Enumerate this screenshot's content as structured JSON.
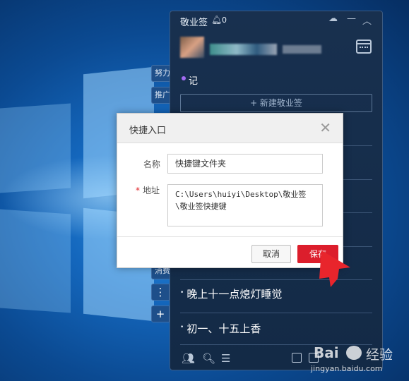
{
  "app": {
    "title": "敬业签",
    "notification_count": "0",
    "icons": [
      "bell-icon",
      "cloud-icon",
      "minimize-icon",
      "collapse-icon",
      "calendar-icon"
    ]
  },
  "section": {
    "label": "记"
  },
  "new_note_button": "+ 新建敬业签",
  "side_tabs": [
    "努力",
    "推广",
    "消费"
  ],
  "side_buttons": {
    "more": "⋮",
    "add": "+"
  },
  "notes": [
    "晚上十一点熄灯睡觉",
    "初一、十五上香"
  ],
  "dialog": {
    "title": "快捷入口",
    "name_label": "名称",
    "name_value": "快捷键文件夹",
    "address_label": "地址",
    "address_value": "C:\\Users\\huiyi\\Desktop\\敬业签\\敬业签快捷键",
    "cancel": "取消",
    "save": "保存"
  },
  "colors": {
    "accent_red": "#dc1e2c",
    "app_bg": "#132a46",
    "section_dot": "#a26cf2"
  },
  "watermark": {
    "brand": "Bai",
    "text": "经验",
    "url": "jingyan.baidu.com"
  }
}
